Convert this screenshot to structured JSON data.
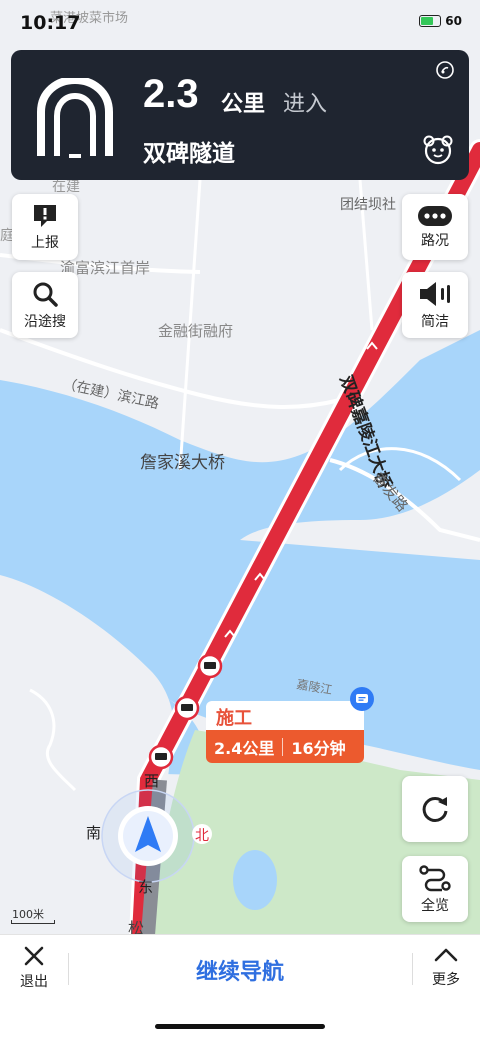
{
  "status_bar": {
    "time": "10:17",
    "battery_percent": "60",
    "battery_level": 0.6
  },
  "guidance": {
    "distance": "2.3",
    "unit": "公里",
    "action": "进入",
    "road_name": "双碑隧道",
    "maneuver_icon": "tunnel-icon"
  },
  "side_buttons": {
    "report": "上报",
    "search_along": "沿途搜",
    "traffic": "路况",
    "brief": "简洁",
    "overview": "全览"
  },
  "map_labels": {
    "top_market": "菜港坡菜市场",
    "zaijian": "在建",
    "jie": "庭",
    "tuanjieba": "团结坝社",
    "yufu": "渝富滨江首岸",
    "jinrong": "金融街融府",
    "binjiang_road": "（在建）滨江路",
    "canjiaxi": "詹家溪大桥",
    "bridge": "双碑嘉陵江大桥",
    "qifa_road": "奋发路",
    "jialing": "嘉陵江",
    "pine": "松"
  },
  "compass": {
    "west": "西",
    "south": "南",
    "north": "北",
    "east": "东"
  },
  "incident": {
    "type": "施工",
    "distance": "2.4公里",
    "duration": "16分钟"
  },
  "scale": {
    "label": "100米"
  },
  "bottom_bar": {
    "exit": "退出",
    "continue": "继续导航",
    "more": "更多"
  },
  "colors": {
    "route": "#e02b3c",
    "water": "#a8d5fa",
    "land": "#eff1f5",
    "park": "#cde8c8",
    "card": "#1f2530",
    "accent": "#2f6fe0"
  }
}
